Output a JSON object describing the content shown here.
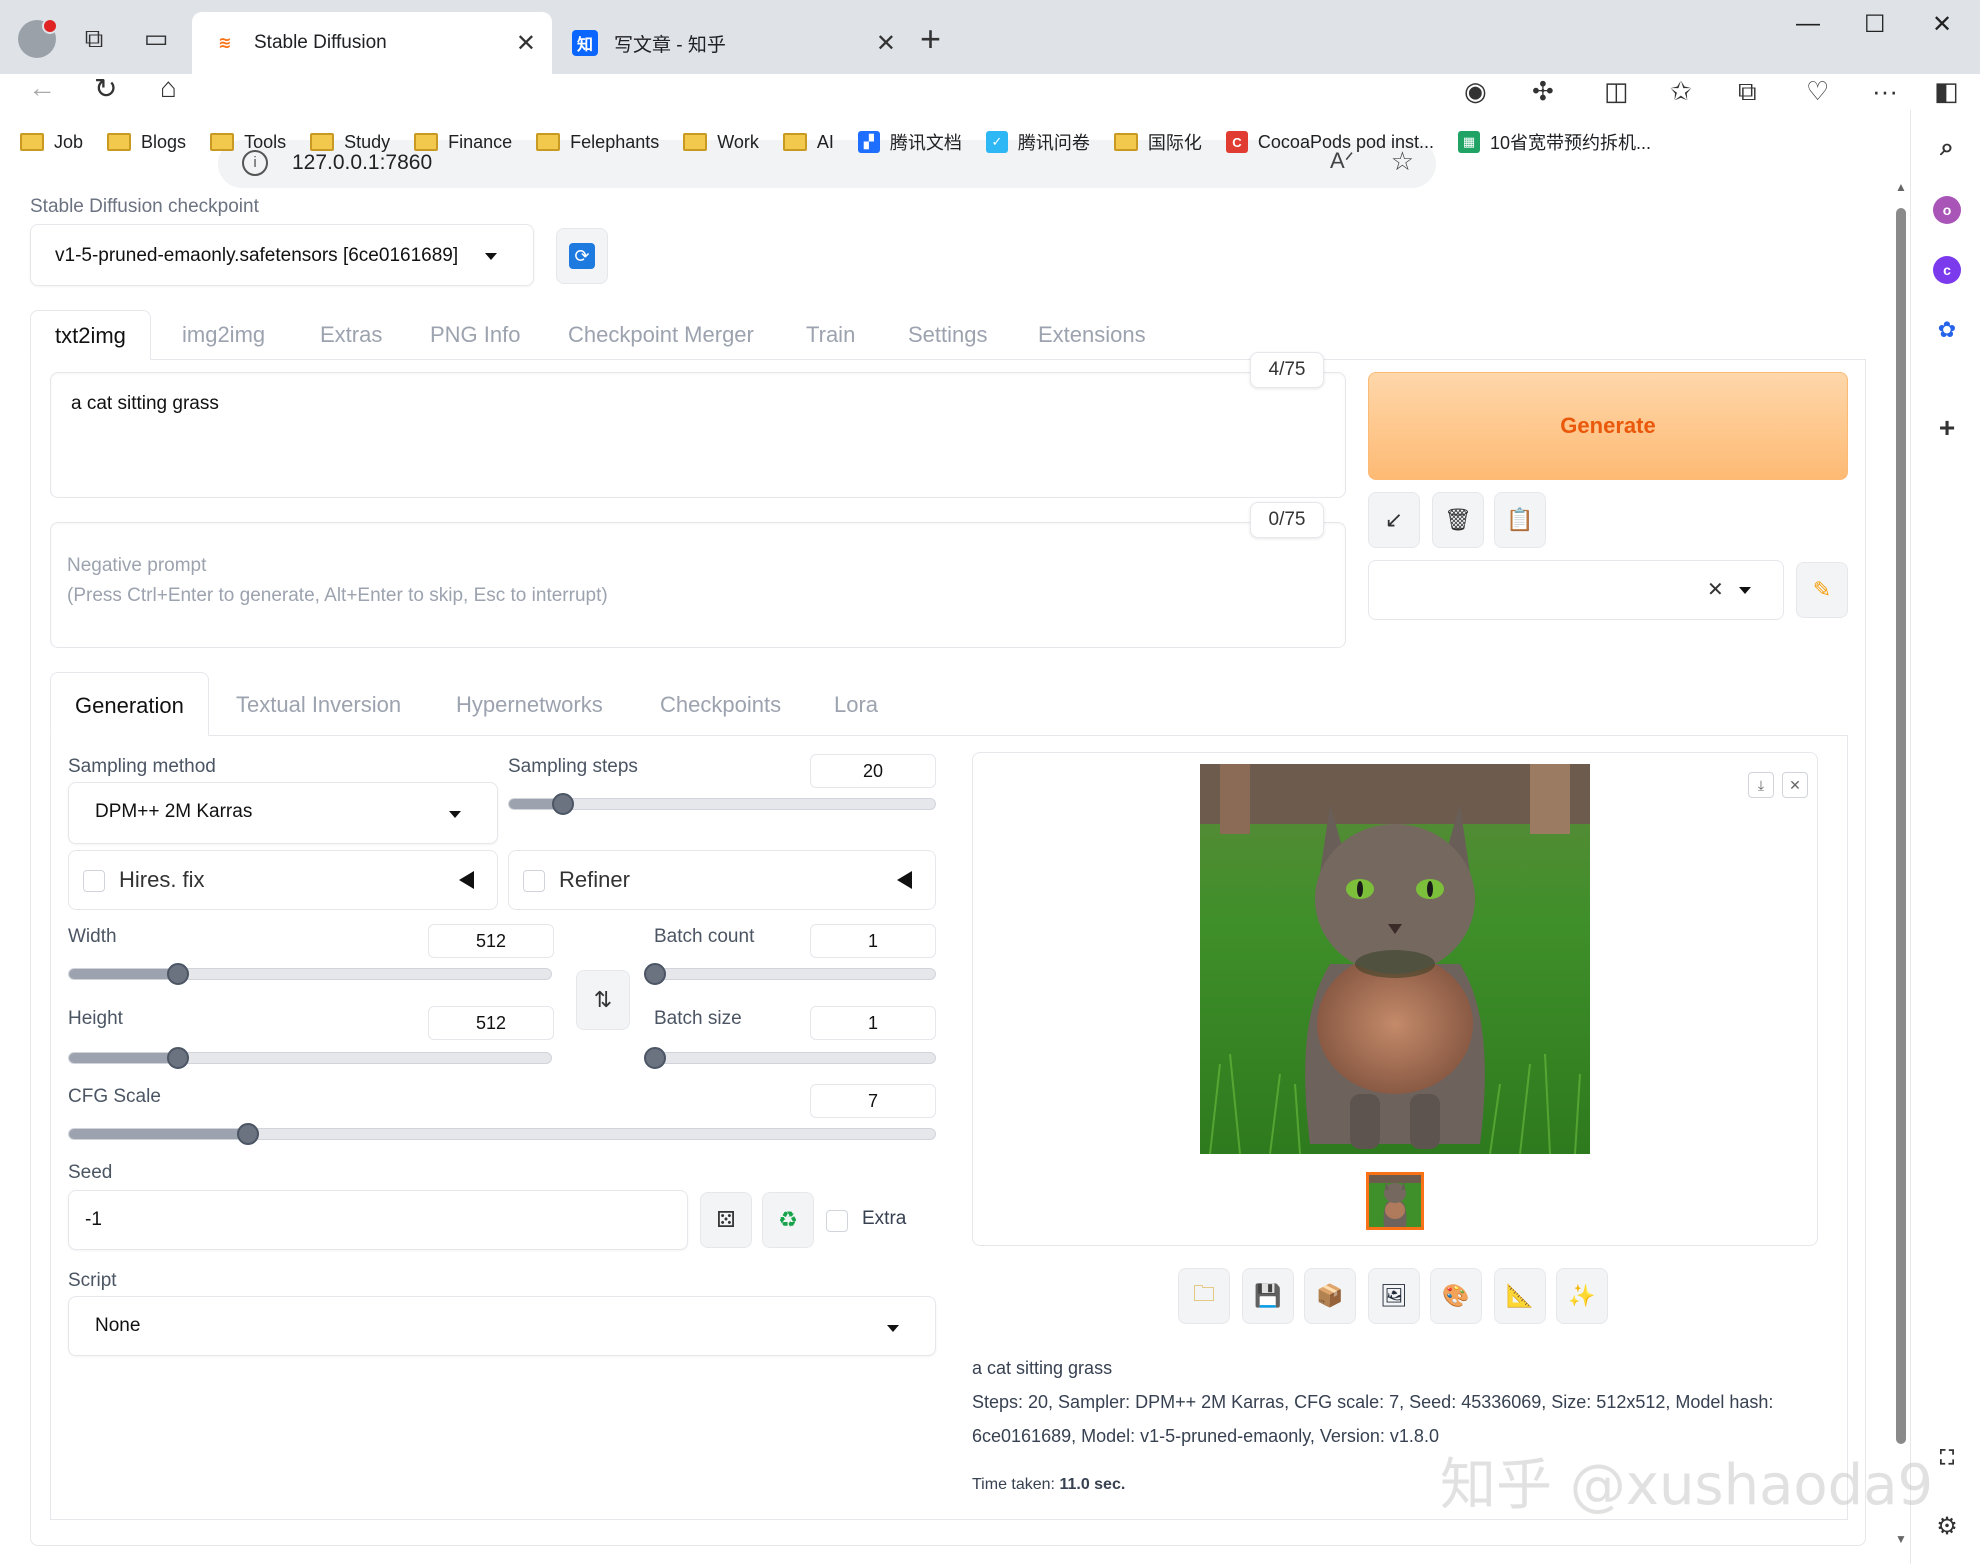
{
  "browser": {
    "tabs": [
      {
        "title": "Stable Diffusion",
        "active": true
      },
      {
        "title": "写文章 - 知乎",
        "active": false,
        "favicon": "知"
      }
    ],
    "url": "127.0.0.1:7860",
    "bookmarks": [
      {
        "label": "Job",
        "type": "folder"
      },
      {
        "label": "Blogs",
        "type": "folder"
      },
      {
        "label": "Tools",
        "type": "folder"
      },
      {
        "label": "Study",
        "type": "folder"
      },
      {
        "label": "Finance",
        "type": "folder"
      },
      {
        "label": "Felephants",
        "type": "folder"
      },
      {
        "label": "Work",
        "type": "folder"
      },
      {
        "label": "AI",
        "type": "folder"
      },
      {
        "label": "腾讯文档",
        "type": "site"
      },
      {
        "label": "腾讯问卷",
        "type": "site"
      },
      {
        "label": "国际化",
        "type": "folder"
      },
      {
        "label": "CocoaPods pod inst...",
        "type": "site"
      },
      {
        "label": "10省宽带预约拆机...",
        "type": "site"
      }
    ],
    "sidebar_badges": [
      "o",
      "c"
    ]
  },
  "app": {
    "checkpoint_label": "Stable Diffusion checkpoint",
    "checkpoint_value": "v1-5-pruned-emaonly.safetensors [6ce0161689]",
    "main_tabs": [
      "txt2img",
      "img2img",
      "Extras",
      "PNG Info",
      "Checkpoint Merger",
      "Train",
      "Settings",
      "Extensions"
    ],
    "prompt": {
      "value": "a cat sitting grass",
      "counter": "4/75"
    },
    "negative_prompt": {
      "placeholder_line1": "Negative prompt",
      "placeholder_line2": "(Press Ctrl+Enter to generate, Alt+Enter to skip, Esc to interrupt)",
      "counter": "0/75"
    },
    "generate_label": "Generate",
    "sub_tabs": [
      "Generation",
      "Textual Inversion",
      "Hypernetworks",
      "Checkpoints",
      "Lora"
    ],
    "sampling_method": {
      "label": "Sampling method",
      "value": "DPM++ 2M Karras"
    },
    "sampling_steps": {
      "label": "Sampling steps",
      "value": "20",
      "min": 1,
      "max": 150
    },
    "hires_fix": {
      "label": "Hires. fix",
      "checked": false
    },
    "refiner": {
      "label": "Refiner",
      "checked": false
    },
    "width": {
      "label": "Width",
      "value": "512",
      "min": 64,
      "max": 2048
    },
    "height": {
      "label": "Height",
      "value": "512",
      "min": 64,
      "max": 2048
    },
    "batch_count": {
      "label": "Batch count",
      "value": "1",
      "min": 1,
      "max": 100
    },
    "batch_size": {
      "label": "Batch size",
      "value": "1",
      "min": 1,
      "max": 8
    },
    "cfg_scale": {
      "label": "CFG Scale",
      "value": "7",
      "min": 1,
      "max": 30
    },
    "seed": {
      "label": "Seed",
      "value": "-1"
    },
    "extra_label": "Extra",
    "script": {
      "label": "Script",
      "value": "None"
    },
    "output": {
      "prompt_text": "a cat sitting grass",
      "params_line1": "Steps: 20, Sampler: DPM++ 2M Karras, CFG scale: 7, Seed: 45336069, Size: 512x512, Model hash:",
      "params_line2": "6ce0161689, Model: v1-5-pruned-emaonly, Version: v1.8.0",
      "time_label": "Time taken:",
      "time_value": "11.0 sec."
    },
    "watermark": "知乎 @xushaoda9"
  }
}
